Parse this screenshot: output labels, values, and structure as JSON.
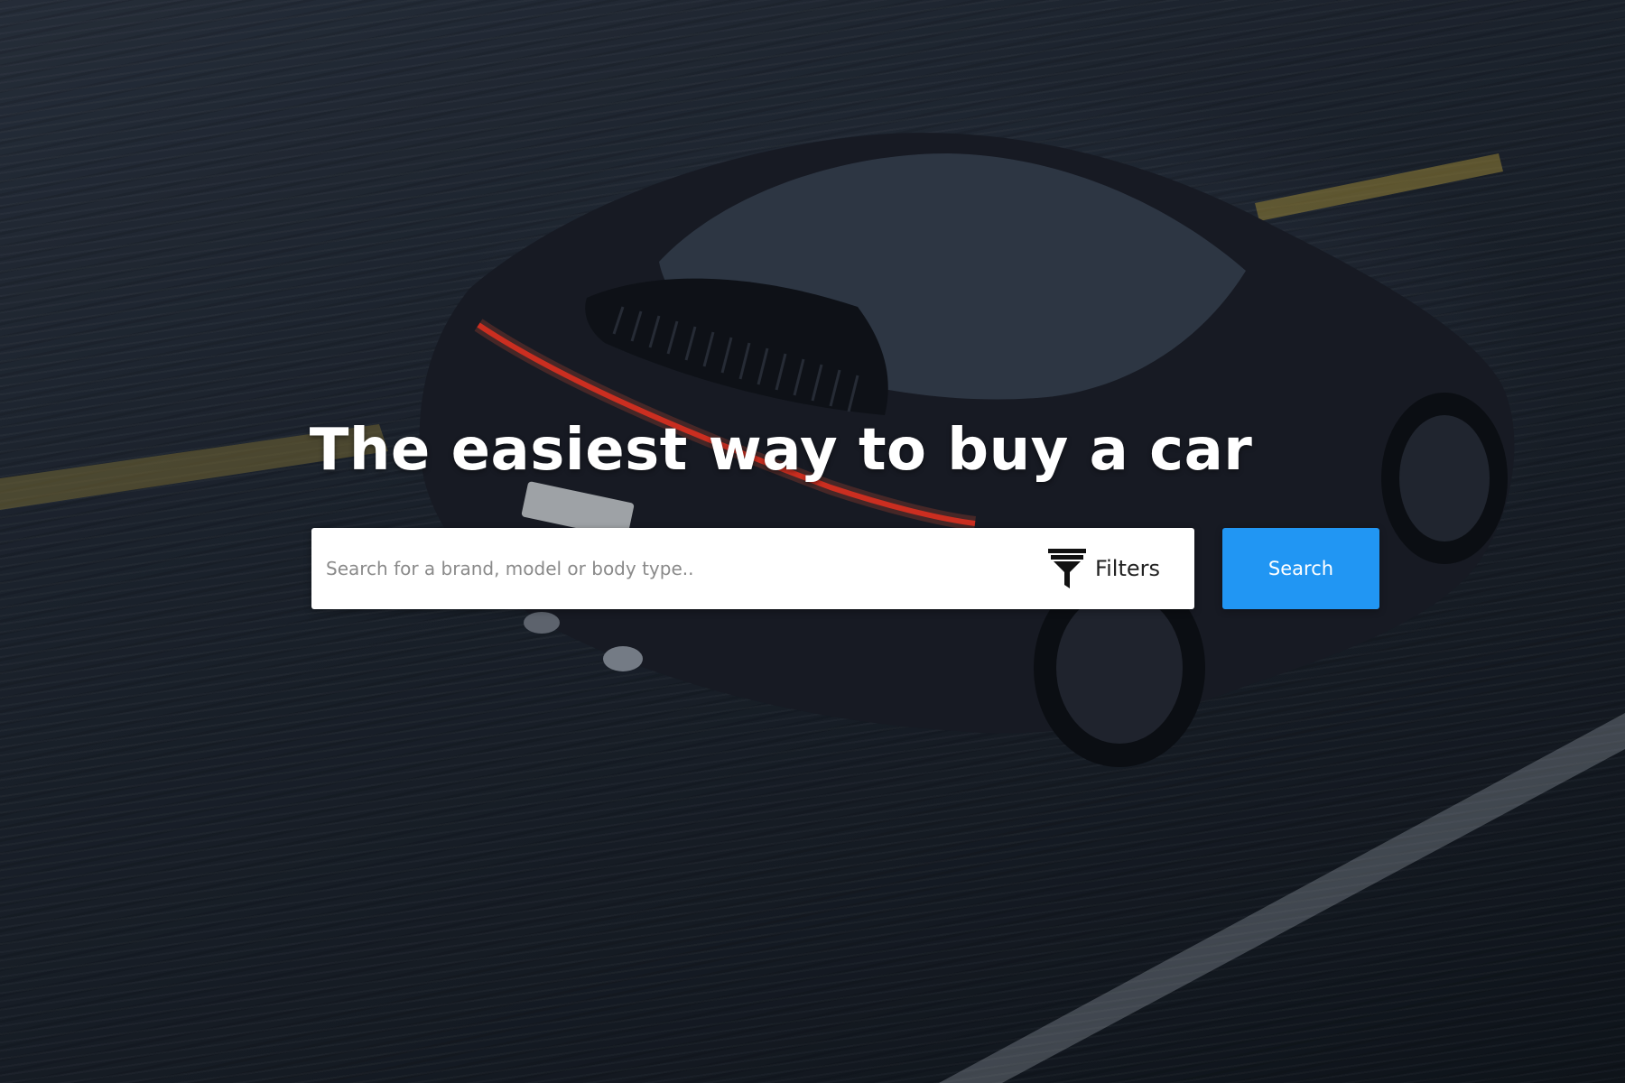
{
  "hero": {
    "headline": "The easiest way to buy a car",
    "background_image": "sports-car-on-road-photo"
  },
  "search": {
    "placeholder": "Search for a brand, model or body type..",
    "value": "",
    "filters_label": "Filters",
    "filters_icon": "funnel-icon",
    "button_label": "Search"
  },
  "colors": {
    "accent": "#2196f3",
    "headline": "#ffffff",
    "search_box_bg": "#ffffff"
  }
}
